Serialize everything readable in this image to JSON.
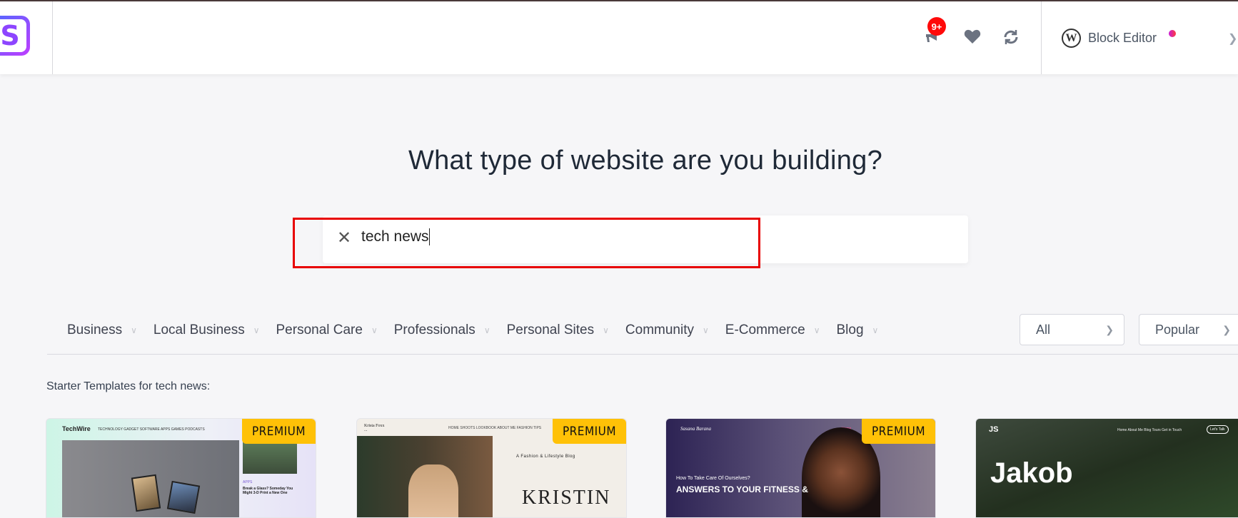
{
  "header": {
    "notifications_count": "9+",
    "editor_label": "Block Editor",
    "icons": [
      "logo",
      "megaphone-icon",
      "heart-icon",
      "refresh-icon",
      "wordpress-icon",
      "chevron-down-icon"
    ]
  },
  "main": {
    "title": "What type of website are you building?",
    "search": {
      "value": "tech news",
      "clear_icon": "close-icon"
    },
    "categories": [
      {
        "label": "Business"
      },
      {
        "label": "Local Business"
      },
      {
        "label": "Personal Care"
      },
      {
        "label": "Professionals"
      },
      {
        "label": "Personal Sites"
      },
      {
        "label": "Community"
      },
      {
        "label": "E-Commerce"
      },
      {
        "label": "Blog"
      }
    ],
    "filter_type": "All",
    "sort": "Popular",
    "results_label": "Starter Templates for tech news:"
  },
  "templates": [
    {
      "badge": "PREMIUM",
      "logo": "TechWire",
      "nav": "TECHNOLOGY   GADGET   SOFTWARE   APPS   GAMES   PODCASTS",
      "tag": "APPS",
      "headline": "Break a Glass? Someday You Might 3-D Print a New One"
    },
    {
      "badge": "PREMIUM",
      "logo": "Krista Foxx ...",
      "nav": "HOME   SHOOTS   LOOKBOOK   ABOUT ME   FASHION TIPS",
      "tagline": "A Fashion & Lifestyle Blog",
      "headline": "KRISTIN"
    },
    {
      "badge": "PREMIUM",
      "logo": "Sasana Barana",
      "nav": "Home",
      "tagline": "How To Take Care Of Ourselves?",
      "headline": "ANSWERS TO YOUR FITNESS &"
    },
    {
      "logo": "JS",
      "nav": "Home   About Me   Blog   Tours   Get in Touch",
      "cta": "Let's Talk",
      "headline": "Jakob"
    }
  ],
  "colors": {
    "accent": "#8d45ff",
    "badge": "#ffc107",
    "notification": "#ff0a0a",
    "highlight": "#e80000"
  }
}
